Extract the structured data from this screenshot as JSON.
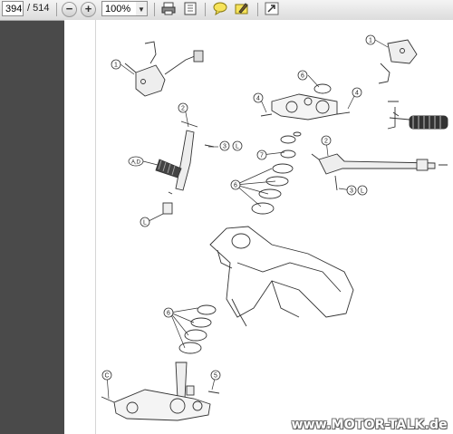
{
  "toolbar": {
    "page_current": "394",
    "page_total": "/ 514",
    "zoom": "100%",
    "icons": [
      "zoom-out-icon",
      "zoom-in-icon",
      "print-icon",
      "fit-page-icon",
      "comment-icon",
      "highlight-icon",
      "expand-icon"
    ]
  },
  "diagram": {
    "callouts": [
      "1",
      "1",
      "2",
      "2",
      "3",
      "3",
      "4",
      "4",
      "5",
      "6",
      "6",
      "6",
      "7",
      "A,D",
      "L",
      "L",
      "C",
      "C"
    ],
    "labels": {
      "top_left_1": "1",
      "top_right_1": "1",
      "clamp_6": "6",
      "bolt_4_left": "4",
      "bolt_4_right": "4",
      "bolt_2_left": "2",
      "bolt_2_right": "2",
      "torque_3_left": "3",
      "torque_3_right": "3",
      "torque_L_left": "L",
      "torque_L_right": "L",
      "nut_7": "7",
      "bearing_6": "6",
      "grip_AD": "A,D",
      "lock_L": "L",
      "lower_6": "6",
      "stem_C": "C",
      "bolt_5": "5"
    }
  },
  "watermark": "www.MOTOR-TALK.de"
}
